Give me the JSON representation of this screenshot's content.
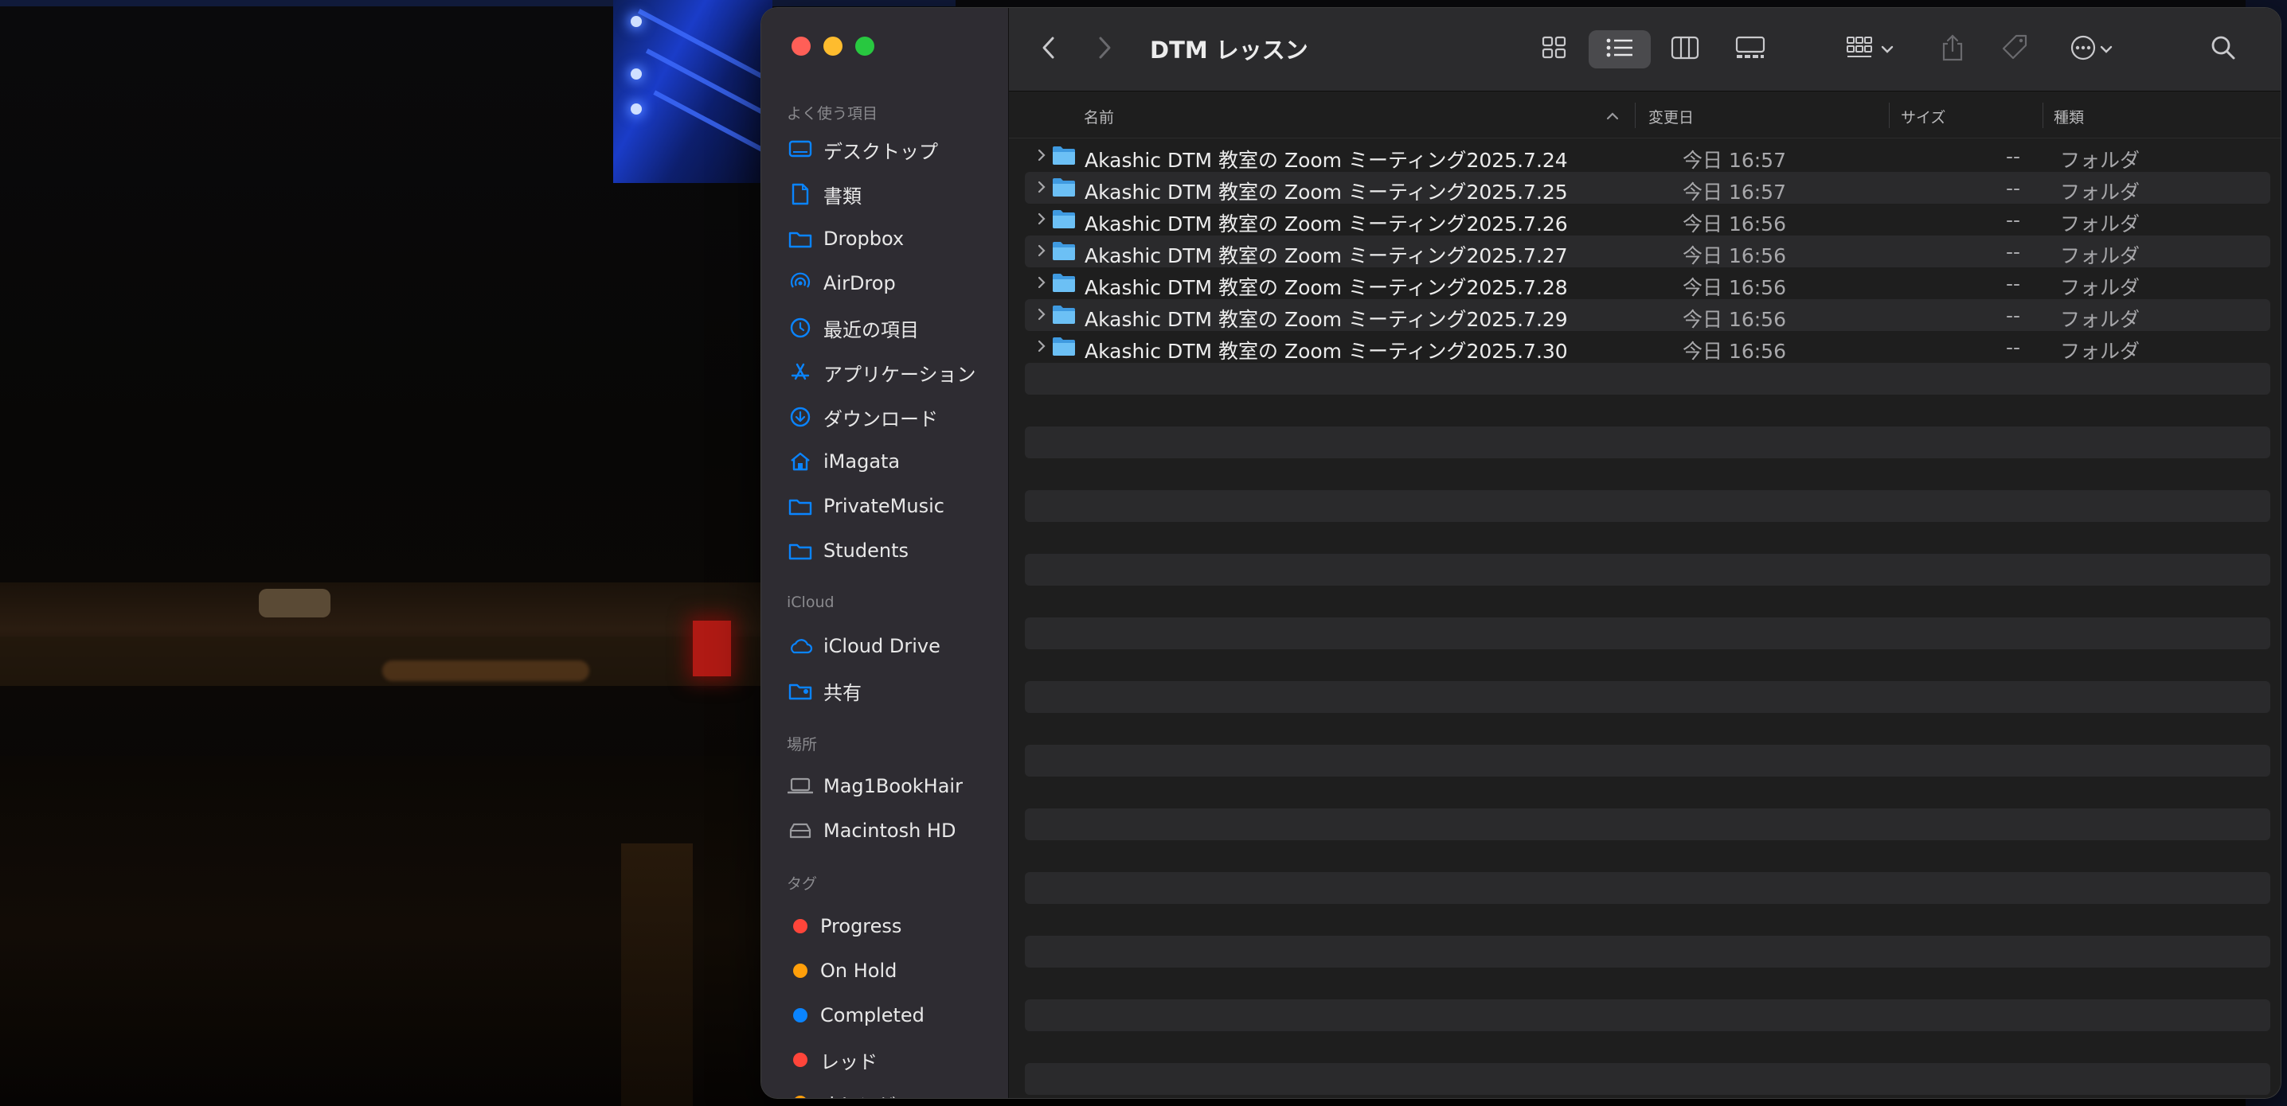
{
  "window": {
    "title": "DTM レッスン"
  },
  "toolbar": {
    "back_icon": "chevron-left-icon",
    "forward_icon": "chevron-right-icon",
    "view_modes": [
      "icon-view",
      "list-view",
      "column-view",
      "gallery-view"
    ],
    "selected_view": "list-view"
  },
  "sidebar": {
    "favorites_header": "よく使う項目",
    "favorites": [
      {
        "label": "デスクトップ",
        "icon": "desktop-icon"
      },
      {
        "label": "書類",
        "icon": "document-icon"
      },
      {
        "label": "Dropbox",
        "icon": "folder-icon"
      },
      {
        "label": "AirDrop",
        "icon": "airdrop-icon"
      },
      {
        "label": "最近の項目",
        "icon": "clock-icon"
      },
      {
        "label": "アプリケーション",
        "icon": "applications-icon"
      },
      {
        "label": "ダウンロード",
        "icon": "download-icon"
      },
      {
        "label": "iMagata",
        "icon": "home-icon"
      },
      {
        "label": "PrivateMusic",
        "icon": "folder-icon"
      },
      {
        "label": "Students",
        "icon": "folder-icon"
      }
    ],
    "icloud_header": "iCloud",
    "icloud": [
      {
        "label": "iCloud Drive",
        "icon": "cloud-icon"
      },
      {
        "label": "共有",
        "icon": "shared-folder-icon"
      }
    ],
    "locations_header": "場所",
    "locations": [
      {
        "label": "Mag1BookHair",
        "icon": "laptop-icon"
      },
      {
        "label": "Macintosh HD",
        "icon": "disk-icon"
      }
    ],
    "tags_header": "タグ",
    "tags": [
      {
        "label": "Progress",
        "color": "#ff453a"
      },
      {
        "label": "On Hold",
        "color": "#ff9f0a"
      },
      {
        "label": "Completed",
        "color": "#0a84ff"
      },
      {
        "label": "レッド",
        "color": "#ff453a"
      },
      {
        "label": "オレンジ",
        "color": "#ff9f0a"
      }
    ]
  },
  "columns": {
    "name": "名前",
    "modified": "変更日",
    "size": "サイズ",
    "kind": "種類"
  },
  "files": [
    {
      "name": "Akashic DTM 教室の Zoom ミーティング2025.7.24",
      "modified": "今日 16:57",
      "size": "--",
      "kind": "フォルダ"
    },
    {
      "name": "Akashic DTM 教室の Zoom ミーティング2025.7.25",
      "modified": "今日 16:57",
      "size": "--",
      "kind": "フォルダ"
    },
    {
      "name": "Akashic DTM 教室の Zoom ミーティング2025.7.26",
      "modified": "今日 16:56",
      "size": "--",
      "kind": "フォルダ"
    },
    {
      "name": "Akashic DTM 教室の Zoom ミーティング2025.7.27",
      "modified": "今日 16:56",
      "size": "--",
      "kind": "フォルダ"
    },
    {
      "name": "Akashic DTM 教室の Zoom ミーティング2025.7.28",
      "modified": "今日 16:56",
      "size": "--",
      "kind": "フォルダ"
    },
    {
      "name": "Akashic DTM 教室の Zoom ミーティング2025.7.29",
      "modified": "今日 16:56",
      "size": "--",
      "kind": "フォルダ"
    },
    {
      "name": "Akashic DTM 教室の Zoom ミーティング2025.7.30",
      "modified": "今日 16:56",
      "size": "--",
      "kind": "フォルダ"
    }
  ],
  "colors": {
    "accent": "#0a84ff",
    "folder": "#5ab4f0",
    "close": "#ff5f57",
    "minimize": "#febc2e",
    "maximize": "#28c840"
  }
}
